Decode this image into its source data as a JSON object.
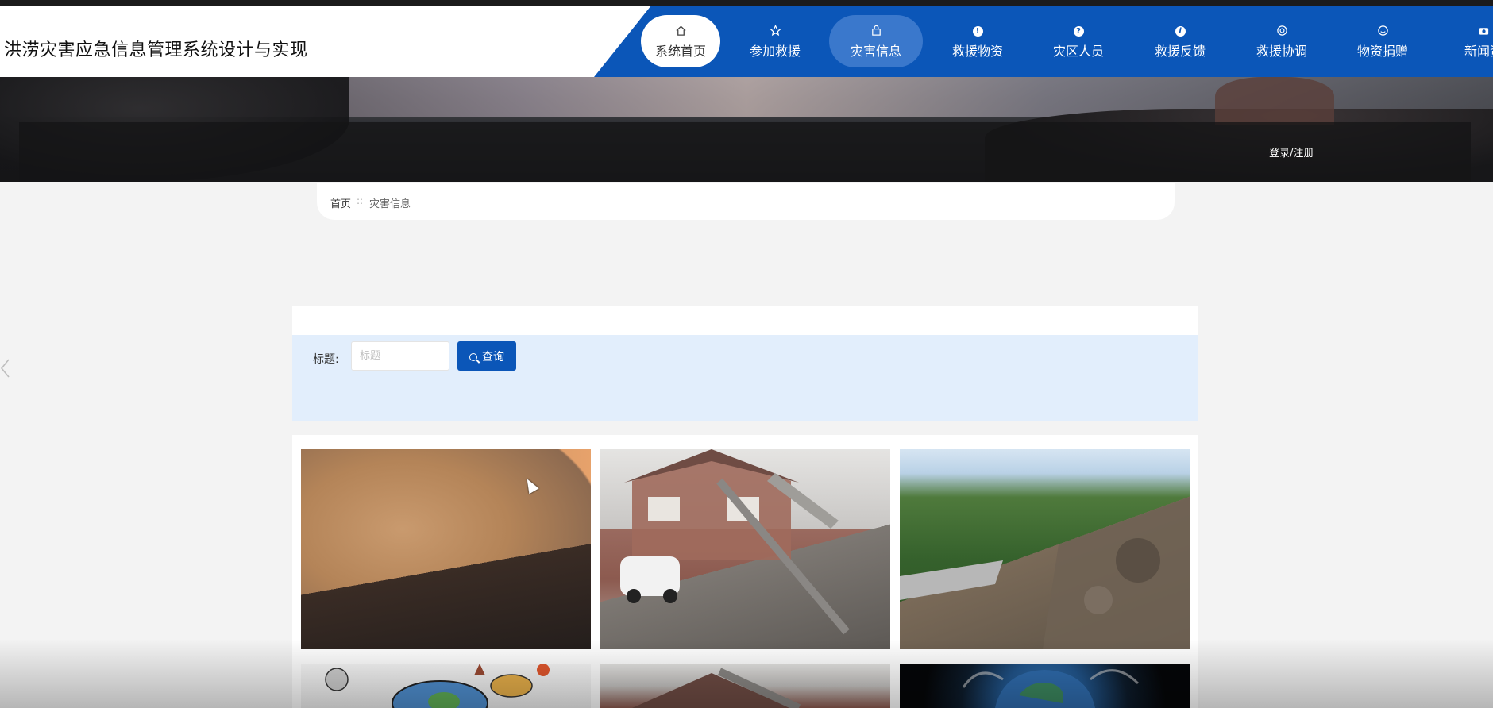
{
  "header": {
    "site_title": "洪涝灾害应急信息管理系统设计与实现"
  },
  "nav": {
    "items": [
      {
        "label": "系统首页",
        "icon": "home-icon"
      },
      {
        "label": "参加救援",
        "icon": "star-icon"
      },
      {
        "label": "灾害信息",
        "icon": "bag-icon"
      },
      {
        "label": "救援物资",
        "icon": "alert-icon"
      },
      {
        "label": "灾区人员",
        "icon": "question-icon"
      },
      {
        "label": "救援反馈",
        "icon": "info-icon"
      },
      {
        "label": "救援协调",
        "icon": "lifebuoy-icon"
      },
      {
        "label": "物资捐赠",
        "icon": "smile-icon"
      },
      {
        "label": "新闻资",
        "icon": "camera-icon"
      }
    ],
    "active_index": 2
  },
  "banner": {
    "login_label": "登录/注册"
  },
  "breadcrumb": {
    "home": "首页",
    "separator": "::",
    "current": "灾害信息"
  },
  "search": {
    "label": "标题:",
    "placeholder": "标题",
    "value": "",
    "button_label": "查询"
  },
  "grid": {
    "cards": [
      {
        "image": "sandstorm-over-city"
      },
      {
        "image": "earthquake-damaged-house"
      },
      {
        "image": "mountain-landslide"
      },
      {
        "image": "natural-disasters-doodle"
      },
      {
        "image": "earthquake-damaged-house"
      },
      {
        "image": "earth-smoke"
      }
    ]
  },
  "colors": {
    "primary": "#0b56b8",
    "nav_active": "#3a78cc",
    "search_panel": "#e2eefc",
    "page_bg": "#f3f3f3"
  }
}
